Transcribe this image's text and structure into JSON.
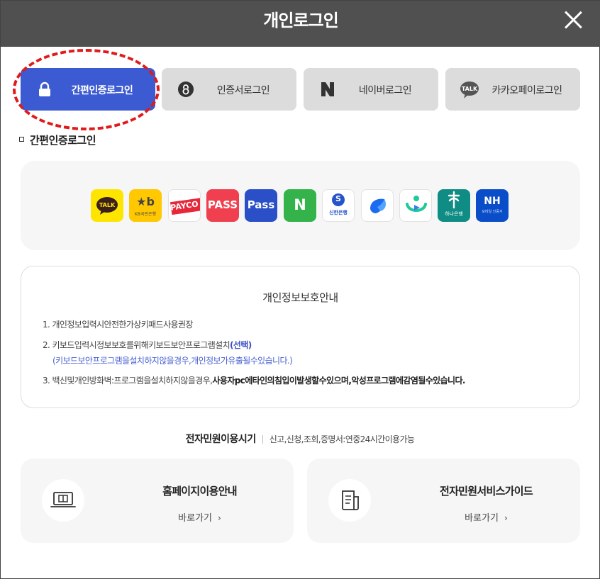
{
  "header": {
    "title": "개인로그인"
  },
  "tabs": [
    {
      "label": "간편인증로그인",
      "icon": "lock-icon",
      "active": true
    },
    {
      "label": "인증서로그인",
      "icon": "certificate-icon",
      "active": false
    },
    {
      "label": "네이버로그인",
      "icon": "naver-icon",
      "active": false
    },
    {
      "label": "카카오페이로그인",
      "icon": "kakaotalk-icon",
      "active": false
    }
  ],
  "section": {
    "title": "간편인증로그인"
  },
  "providers": [
    {
      "name": "kakao",
      "text": "TALK",
      "bg": "#FEE500"
    },
    {
      "name": "kb",
      "text": "KB국민은행",
      "mark": "★b",
      "bg": "#FFC800"
    },
    {
      "name": "payco",
      "text": "PAYCO",
      "bg": "#ffffff"
    },
    {
      "name": "pass-red",
      "text": "PASS",
      "bg": "#F0404F"
    },
    {
      "name": "pass-blue",
      "text": "Pass",
      "bg": "#2A4FC7"
    },
    {
      "name": "naver",
      "text": "N",
      "bg": "#33B34A"
    },
    {
      "name": "shinhan",
      "text": "신한은행",
      "mark": "S",
      "bg": "#ffffff"
    },
    {
      "name": "toss",
      "text": "",
      "bg": "#ffffff"
    },
    {
      "name": "banksalad",
      "text": "",
      "bg": "#ffffff"
    },
    {
      "name": "hana",
      "text": "하나은행",
      "bg": "#0F8C84"
    },
    {
      "name": "nh",
      "text": "NH",
      "sub": "모바일 인증서",
      "bg": "#0A4DC8"
    }
  ],
  "notice": {
    "title": "개인정보보호안내",
    "item1": "1.  개인정보입력시안전한가상키패드사용권장",
    "item2_prefix": "2.  키보드입력시정보보호를위해키보드보안프로그램설치",
    "item2_highlight": "(선택)",
    "item2_sub": "(키보드보안프로그램을설치하지않을경우,개인정보가유출될수있습니다.)",
    "item3_prefix": "3.  백신및개인방화벽:프로그램을설치하지않을경우,",
    "item3_bold": "사용자pc에타인의침입이발생할수있으며,악성프로그램에감염될수있습니다."
  },
  "services": {
    "title": "전자민원이용시기",
    "desc": "신고,신청,조회,증명서:연중24시간이용가능",
    "cards": [
      {
        "title": "홈페이지이용안내",
        "link": "바로가기",
        "arrow": "›",
        "icon": "laptop-icon"
      },
      {
        "title": "전자민원서비스가이드",
        "link": "바로가기",
        "arrow": "›",
        "icon": "document-guide-icon"
      }
    ]
  },
  "colors": {
    "header_bg": "#505050",
    "active_tab": "#3c5ad1",
    "highlight": "#e01a1a",
    "accent_text": "#4a63d2"
  }
}
